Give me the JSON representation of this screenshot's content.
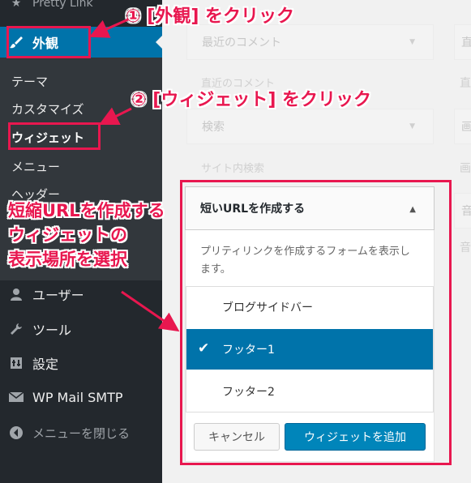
{
  "sidebar": {
    "pretty_link": "Pretty Link",
    "appearance": "外観",
    "submenu": [
      "テーマ",
      "カスタマイズ",
      "ウィジェット",
      "メニュー",
      "ヘッダー"
    ],
    "users": "ユーザー",
    "tools": "ツール",
    "settings": "設定",
    "wp_mail": "WP Mail SMTP",
    "collapse": "メニューを閉じる"
  },
  "background": {
    "recent_comments": "最近のコメント",
    "recent_comments_desc": "直近のコメント",
    "search": "検索",
    "search_desc": "サイト内検索",
    "right_col": [
      "直",
      "画",
      "画",
      "音",
      "音"
    ]
  },
  "widget": {
    "title": "短いURLを作成する",
    "description": "プリティリンクを作成するフォームを表示します。",
    "options": [
      {
        "label": "ブログサイドバー",
        "selected": false
      },
      {
        "label": "フッター1",
        "selected": true
      },
      {
        "label": "フッター2",
        "selected": false
      }
    ],
    "cancel": "キャンセル",
    "add": "ウィジェットを追加"
  },
  "annotations": {
    "step1": "① [外観] をクリック",
    "step2": "② [ウィジェット] をクリック",
    "step3_line1": "短縮URLを作成する",
    "step3_line2": "ウィジェットの",
    "step3_line3": "表示場所を選択"
  },
  "colors": {
    "accent": "#0073aa",
    "annotation": "#e8174f",
    "sidebar": "#23282d"
  }
}
